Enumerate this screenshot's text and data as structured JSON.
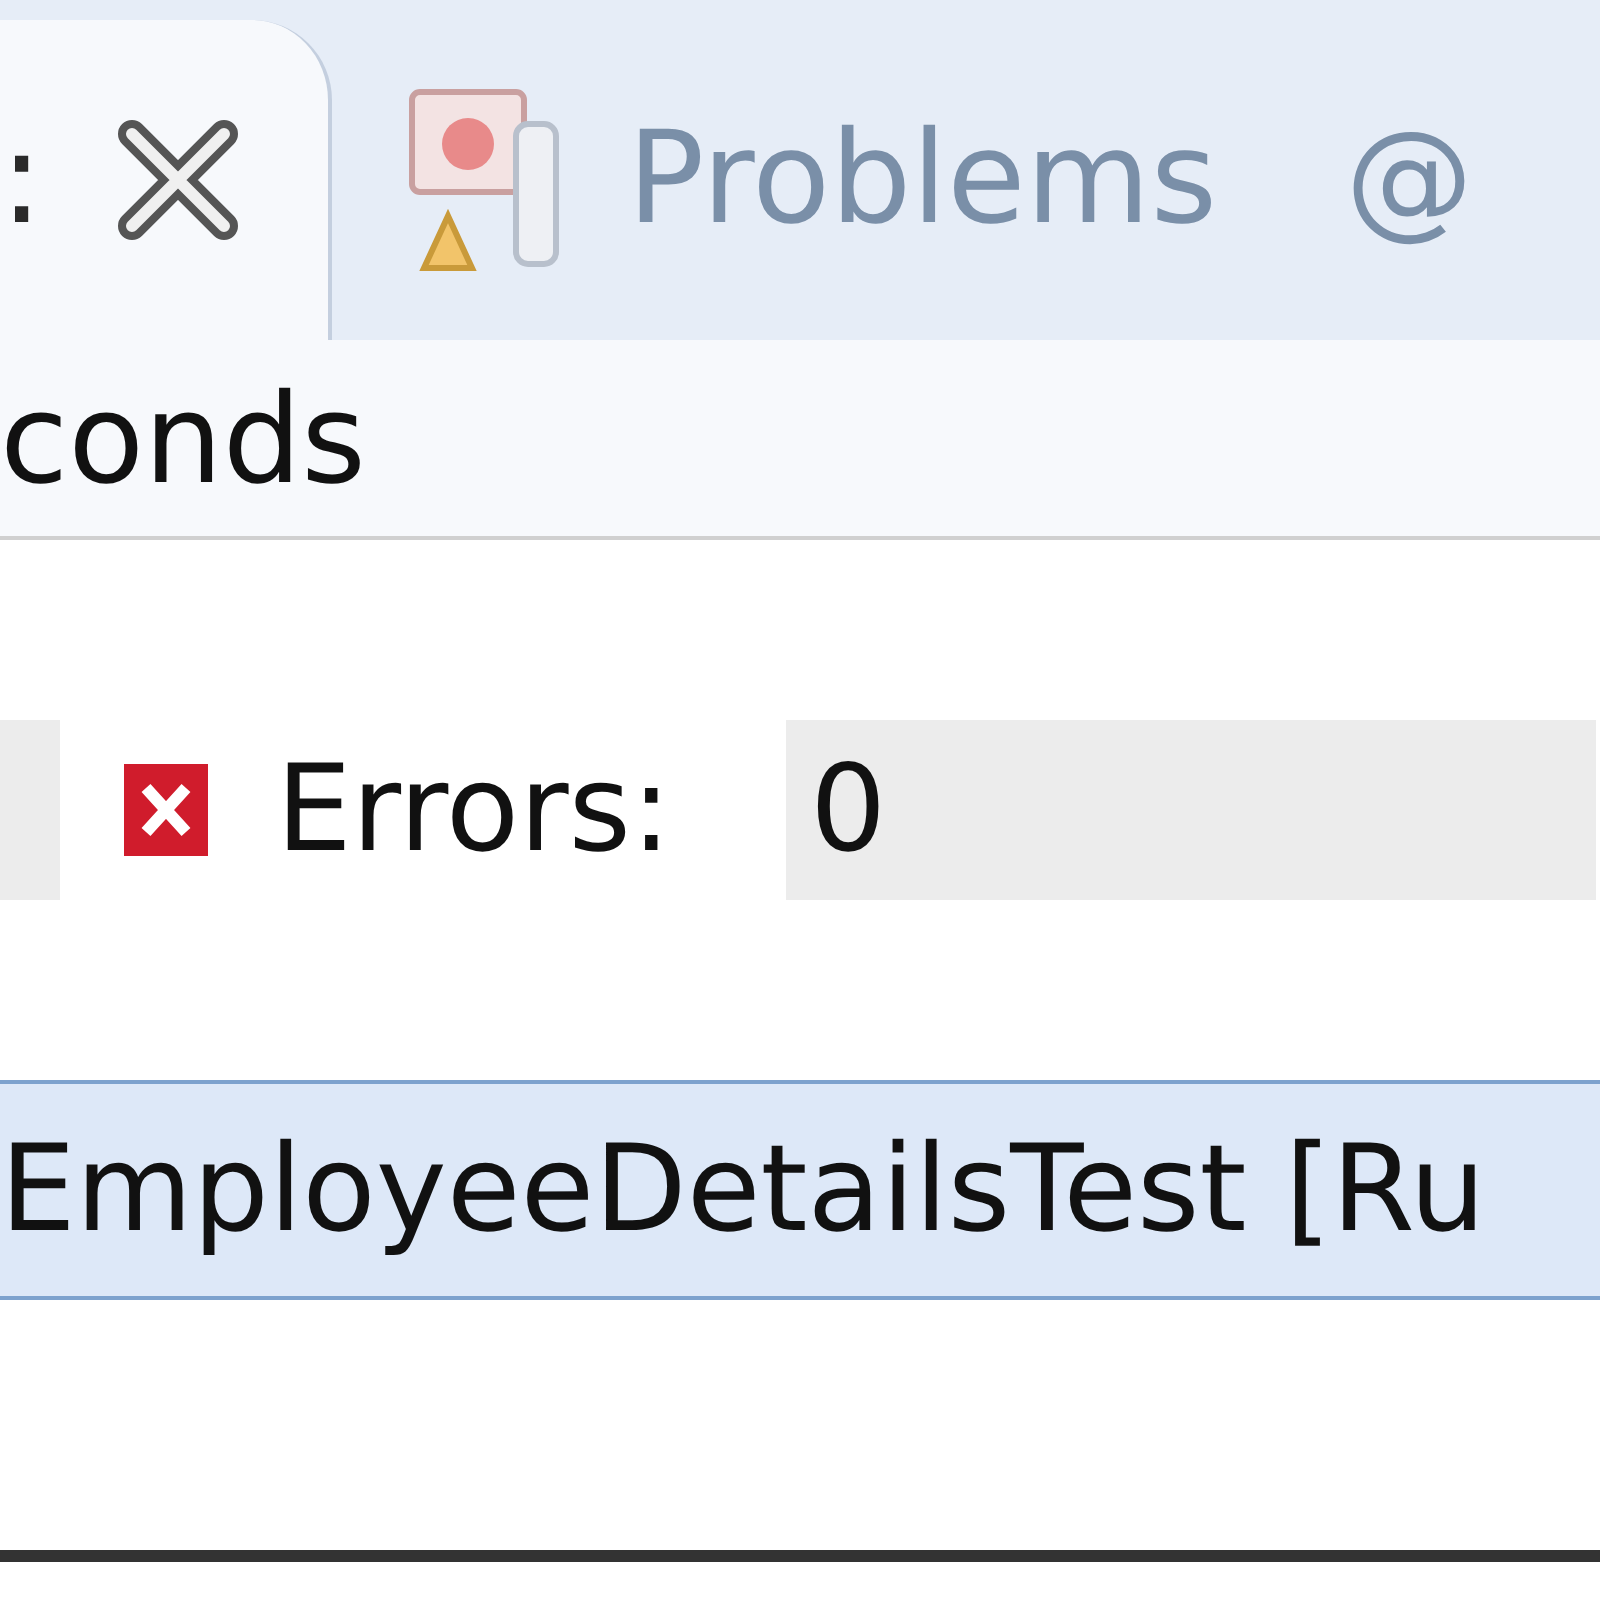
{
  "tabs": [
    {
      "label": ":",
      "selected": true,
      "kind": "closable"
    },
    {
      "label": "Problems",
      "selected": false,
      "kind": "problems"
    },
    {
      "label": "@",
      "selected": false,
      "kind": "plain"
    }
  ],
  "status": "conds",
  "counters": [
    {
      "label": "Errors:",
      "value": "0"
    }
  ],
  "tree": [
    {
      "label": "EmployeeDetailsTest [Ru",
      "selected": true
    }
  ]
}
